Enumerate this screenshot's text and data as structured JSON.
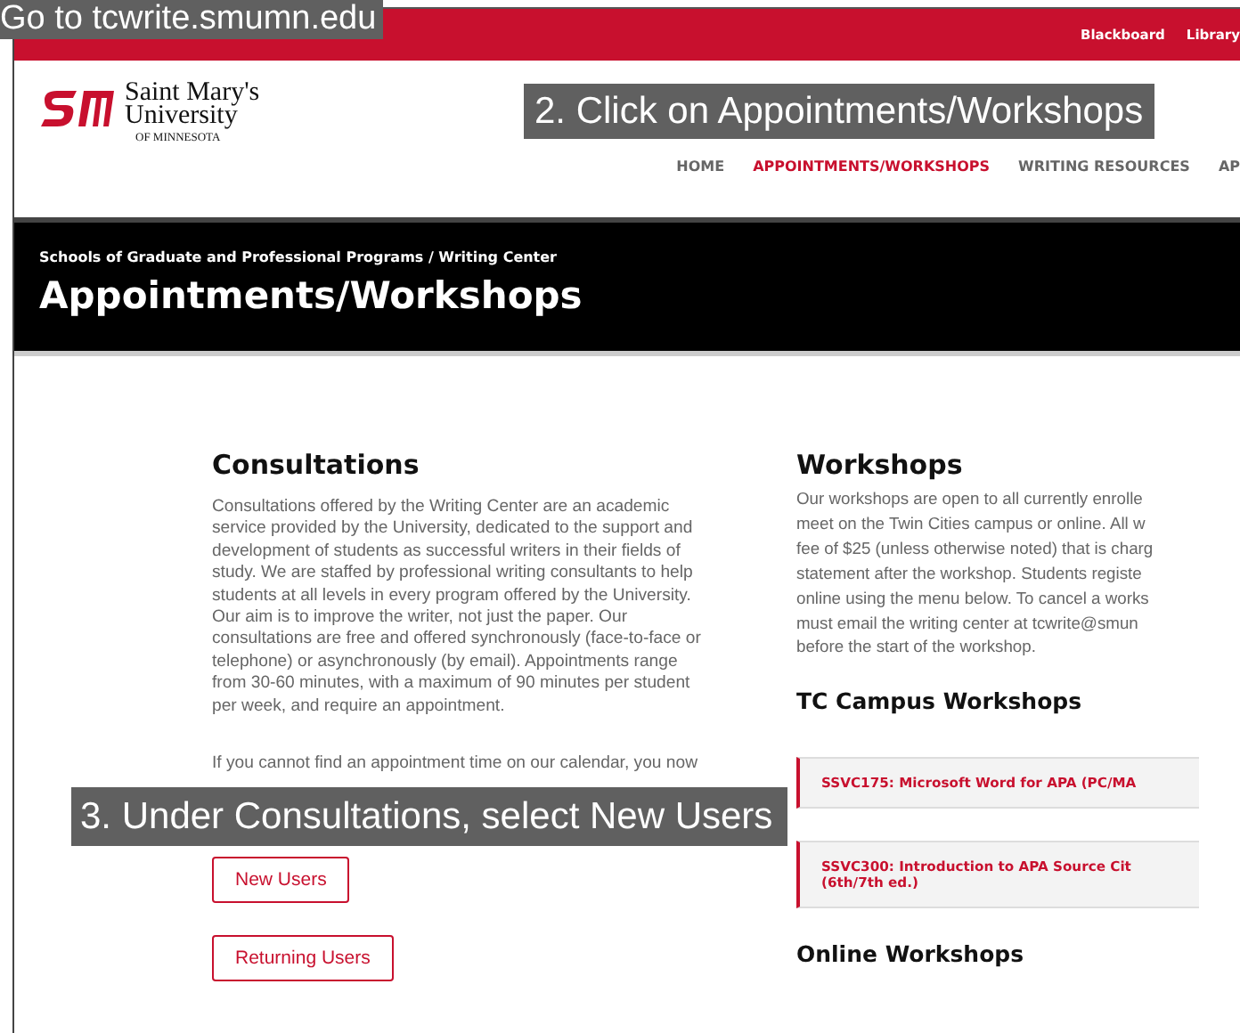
{
  "top_bar": {
    "links": [
      "Blackboard",
      "Library"
    ]
  },
  "logo": {
    "name_line_1": "Saint Mary's",
    "name_line_2": "University",
    "subtitle": "OF MINNESOTA"
  },
  "nav": [
    {
      "label": "HOME",
      "selected": false
    },
    {
      "label": "APPOINTMENTS/WORKSHOPS",
      "selected": true
    },
    {
      "label": "WRITING RESOURCES",
      "selected": false
    },
    {
      "label": "AP",
      "selected": false
    }
  ],
  "banner": {
    "breadcrumb": "Schools of Graduate and Professional Programs / Writing Center",
    "title": "Appointments/Workshops"
  },
  "consultations": {
    "heading": "Consultations",
    "paragraph": "Consultations offered by the Writing Center are an academic service provided by the University, dedicated to the support and development of students as successful writers in their fields of study. We are staffed by professional writing consultants to help students at all levels in every program offered by the University. Our aim is to improve the writer, not just the paper. Our consultations are free and offered synchronously (face-to-face or telephone) or asynchronously (by email). Appointments range from 30-60 minutes, with a maximum of 90 minutes per student per week, and require an appointment.",
    "paragraph_2": "If you cannot find an appointment time on our calendar, you now",
    "buttons": [
      "New Users",
      "Returning Users"
    ]
  },
  "workshops": {
    "heading": "Workshops",
    "paragraph_lines": [
      "Our workshops are open to all currently enrolle",
      "meet on the Twin Cities campus or online. All w",
      "fee of $25 (unless otherwise noted) that is charg",
      "statement after the workshop. Students registe",
      "online using the menu below. To cancel a works",
      "must email the writing center at tcwrite@smun",
      "before the start of the workshop."
    ],
    "tc_heading": "TC Campus Workshops",
    "tc_items": [
      [
        "SSVC175: Microsoft Word for APA (PC/MA"
      ],
      [
        "SSVC300: Introduction to APA Source Cit",
        "(6th/7th ed.)"
      ]
    ],
    "online_heading": "Online Workshops"
  },
  "annotations": [
    "Go to tcwrite.smumn.edu",
    "2. Click on Appointments/Workshops",
    "3. Under Consultations, select New Users"
  ]
}
